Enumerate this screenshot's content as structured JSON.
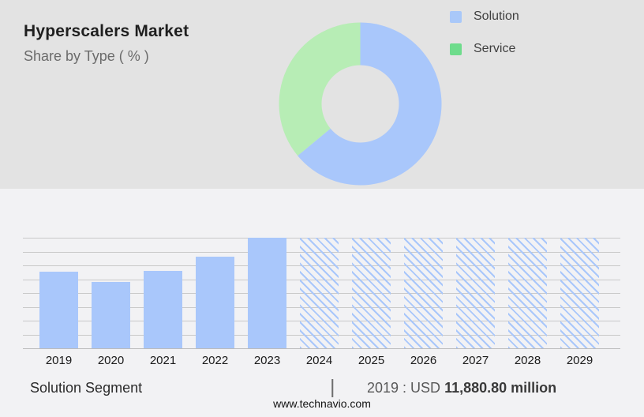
{
  "header": {
    "title": "Hyperscalers Market",
    "subtitle": "Share by Type ( % )"
  },
  "legend": {
    "items": [
      {
        "label": "Solution",
        "swatch_color": "#a9c8f9"
      },
      {
        "label": "Service",
        "swatch_color": "#6edc8c"
      }
    ]
  },
  "colors": {
    "top_background": "#e3e3e3",
    "bottom_background": "#f2f2f4",
    "solution_blue": "#a9c7fb",
    "service_green": "#b7edb5",
    "gridline_gray": "#c9c9c9"
  },
  "chart_data": [
    {
      "type": "pie",
      "subtype": "donut",
      "title": "Share by Type ( % )",
      "legend_position": "top-right",
      "labels_on_chart": false,
      "slices": [
        {
          "name": "Solution",
          "pct_est": 64,
          "color": "#a9c7fb"
        },
        {
          "name": "Service",
          "pct_est": 36,
          "color": "#b7edb5"
        }
      ]
    },
    {
      "type": "bar",
      "title": "Solution Segment market size by year (USD million)",
      "xlabel": "",
      "ylabel": "",
      "y_axis_labels_shown": false,
      "gridline_count": 9,
      "legend_position": "none",
      "bar_color": "#a9c7fb",
      "hatch_color": "#a9c7fb",
      "categories": [
        "2019",
        "2020",
        "2021",
        "2022",
        "2023",
        "2024",
        "2025",
        "2026",
        "2027",
        "2028",
        "2029"
      ],
      "bars": [
        {
          "year": "2019",
          "height_frac": 0.69,
          "style": "solid",
          "usd_million_est": 11880.8
        },
        {
          "year": "2020",
          "height_frac": 0.6,
          "style": "solid",
          "usd_million_est": 10290
        },
        {
          "year": "2021",
          "height_frac": 0.7,
          "style": "solid",
          "usd_million_est": 12000
        },
        {
          "year": "2022",
          "height_frac": 0.83,
          "style": "solid",
          "usd_million_est": 14210
        },
        {
          "year": "2023",
          "height_frac": 1.0,
          "style": "solid",
          "usd_million_est": 17270
        },
        {
          "year": "2024",
          "height_frac": 1.0,
          "style": "hatched"
        },
        {
          "year": "2025",
          "height_frac": 1.0,
          "style": "hatched"
        },
        {
          "year": "2026",
          "height_frac": 1.0,
          "style": "hatched"
        },
        {
          "year": "2027",
          "height_frac": 1.0,
          "style": "hatched"
        },
        {
          "year": "2028",
          "height_frac": 1.0,
          "style": "hatched"
        },
        {
          "year": "2029",
          "height_frac": 1.0,
          "style": "hatched"
        }
      ]
    }
  ],
  "footer": {
    "segment_label": "Solution Segment",
    "separator": "|",
    "value_prefix": "2019 : USD",
    "value_bold": "11,880.80 million",
    "website": "www.technavio.com"
  }
}
